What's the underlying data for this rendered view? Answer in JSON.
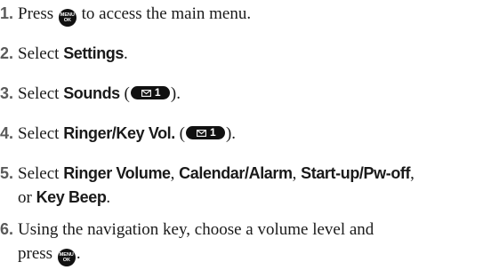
{
  "steps": [
    {
      "number": "1.",
      "before": "Press",
      "key_top": "MENU",
      "key_bottom": "OK",
      "after": "to access the main menu."
    },
    {
      "number": "2.",
      "before": "Select",
      "bold": "Settings",
      "after": "."
    },
    {
      "number": "3.",
      "before": "Select",
      "bold": "Sounds",
      "open": " (",
      "shortcut_digit": "1",
      "close": ")."
    },
    {
      "number": "4.",
      "before": "Select",
      "bold": "Ringer/Key Vol.",
      "open": " (",
      "shortcut_digit": "1",
      "close": ")."
    },
    {
      "number": "5.",
      "before": "Select",
      "option1": "Ringer Volume",
      "sep1": ", ",
      "option2": "Calendar/Alarm",
      "sep2": ", ",
      "option3": "Start-up/Pw-off",
      "sep3": ",",
      "line2_or": "or",
      "option4": "Key Beep",
      "end": "."
    },
    {
      "number": "6.",
      "line1": "Using the navigation key, choose a volume level and",
      "line2": "press",
      "key_top": "MENU",
      "key_bottom": "OK",
      "end": "."
    }
  ],
  "icons": {
    "menu_ok_key": "menu-ok-key-icon",
    "envelope": "envelope-icon"
  },
  "colors": {
    "text": "#1a1a1a",
    "step_number": "#5a5a5a",
    "key_background": "#111111"
  }
}
